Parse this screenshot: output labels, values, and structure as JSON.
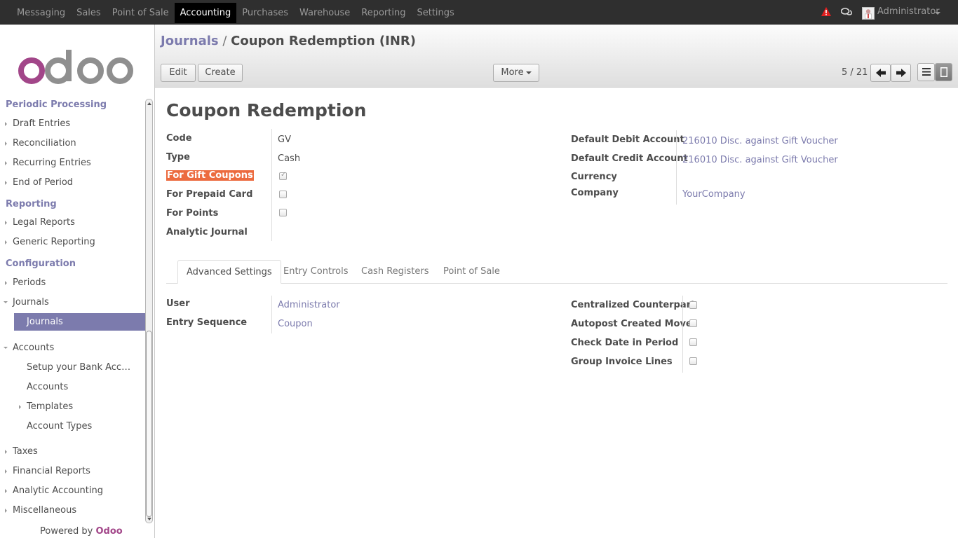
{
  "topmenu": {
    "items": [
      "Messaging",
      "Sales",
      "Point of Sale",
      "Accounting",
      "Purchases",
      "Warehouse",
      "Reporting",
      "Settings"
    ],
    "active": "Accounting"
  },
  "user": {
    "name": "Administrator"
  },
  "sidebar": {
    "logo_text": "odoo",
    "sections": [
      {
        "title": "Periodic Processing",
        "items": [
          "Draft Entries",
          "Reconciliation",
          "Recurring Entries",
          "End of Period"
        ]
      },
      {
        "title": "Reporting",
        "items": [
          "Legal Reports",
          "Generic Reporting"
        ]
      },
      {
        "title": "Configuration",
        "items": [
          "Periods",
          "Journals",
          "Journals",
          "Accounts",
          "Setup your Bank Acc…",
          "Accounts",
          "Templates",
          "Account Types",
          "Taxes",
          "Financial Reports",
          "Analytic Accounting",
          "Miscellaneous"
        ]
      }
    ],
    "powered_by": "Powered by",
    "powered_brand": "Odoo"
  },
  "header": {
    "breadcrumb_link": "Journals",
    "breadcrumb_sep": "/",
    "breadcrumb_current": "Coupon Redemption (INR)",
    "edit_label": "Edit",
    "create_label": "Create",
    "more_label": "More",
    "pager": "5 / 21"
  },
  "form": {
    "title": "Coupon Redemption",
    "left_fields": {
      "code_label": "Code",
      "code_value": "GV",
      "type_label": "Type",
      "type_value": "Cash",
      "gift_label": "For Gift Coupons",
      "gift_checked": true,
      "prepaid_label": "For Prepaid Card",
      "prepaid_checked": false,
      "points_label": "For Points",
      "points_checked": false,
      "analytic_label": "Analytic Journal",
      "analytic_value": ""
    },
    "right_fields": {
      "debit_label": "Default Debit Account",
      "debit_value": "216010 Disc. against Gift Voucher",
      "credit_label": "Default Credit Account",
      "credit_value": "216010 Disc. against Gift Voucher",
      "currency_label": "Currency",
      "currency_value": "",
      "company_label": "Company",
      "company_value": "YourCompany"
    },
    "tabs": [
      "Advanced Settings",
      "Entry Controls",
      "Cash Registers",
      "Point of Sale"
    ],
    "active_tab": "Advanced Settings",
    "advanced": {
      "user_label": "User",
      "user_value": "Administrator",
      "sequence_label": "Entry Sequence",
      "sequence_value": "Coupon",
      "centralized_label": "Centralized Counterpart",
      "centralized_checked": false,
      "autopost_label": "Autopost Created Moves",
      "autopost_checked": false,
      "checkdate_label": "Check Date in Period",
      "checkdate_checked": false,
      "group_label": "Group Invoice Lines",
      "group_checked": false
    }
  },
  "colors": {
    "brand": "#7c7bad",
    "highlight": "#ec6b3f",
    "logo_purple": "#a24689",
    "logo_gray": "#8f8f8f"
  }
}
